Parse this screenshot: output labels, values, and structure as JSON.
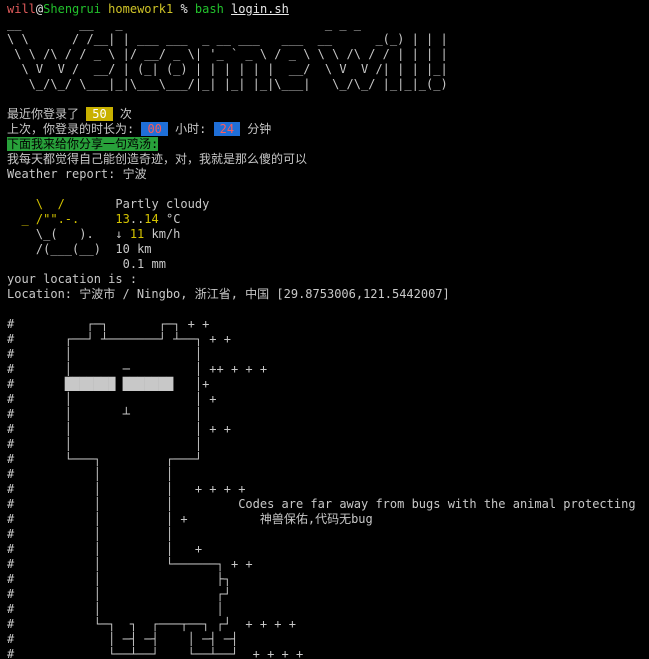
{
  "prompt": {
    "user": "will",
    "at": "@",
    "host": "Shengrui",
    "dir": "homework1",
    "sym": "%"
  },
  "command": {
    "bash": "bash",
    "script": "login.sh"
  },
  "banner": [
    "__        __   _                            _ _ _   ",
    "\\ \\      / /__| | ___ ___  _ __ ___   ___  __      _(_) | | |",
    " \\ \\ /\\ / / _ \\ |/ __/ _ \\| '_ ` _ \\ / _ \\ \\ \\ /\\ / / | | | |",
    "  \\ V  V /  __/ | (_| (_) | | | | | |  __/  \\ V  V /| | | |_|",
    "   \\_/\\_/ \\___|_|\\___\\___/|_| |_| |_|\\___|   \\_/\\_/ |_|_|_(_)"
  ],
  "login_count": {
    "pre": "最近你登录了 ",
    "value": "50",
    "post": " 次"
  },
  "last_login": {
    "pre": "上次，你登录的时长为: ",
    "hours": "00",
    "mid": " 小时: ",
    "minutes": "24",
    "post": " 分钟"
  },
  "soup_header": "下面我来给你分享一句鸡汤:",
  "soup": "我每天都觉得自己能创造奇迹，对，我就是那么傻的可以",
  "weather": {
    "label": "Weather report: ",
    "city": "宁波",
    "art": [
      "    \\  /   ",
      "  _ /\"\".-.  ",
      "    \\_(   ). ",
      "    /(___(__) ",
      "            "
    ],
    "condition": "Partly cloudy",
    "temp": {
      "low": "13",
      "sep": "..",
      "high": "14",
      "unit": " °C"
    },
    "wind": {
      "arrow": "↓ ",
      "speed": "11",
      "unit": " km/h"
    },
    "visibility": "10 km",
    "precip": "0.1 mm"
  },
  "location": {
    "prompt": "your location is :",
    "text": "Location: 宁波市 / Ningbo, 浙江省, 中国 [29.8753006,121.5442007]"
  },
  "animal": [
    "#          ┌─┐       ┌─┐ + +",
    "#       ┌──┘ ┴───────┘ ┴──┐ + +",
    "#       │                 │",
    "#       │       ─         │ ++ + + +",
    "#       ███████ ███████   │+",
    "#       │                 │ +",
    "#       │       ┴         │",
    "#       │                 │ + +",
    "#       │                 │",
    "#       └───┐         ┌───┘",
    "#           │         │",
    "#           │         │   + + + +",
    "#           │         │         Codes are far away from bugs with the animal protecting",
    "#           │         │ +          神兽保佑,代码无bug",
    "#           │         │",
    "#           │         │   +",
    "#           │         └──────┐ + +",
    "#           │                ├┐",
    "#           │                ┌┘",
    "#           │                │",
    "#           └─┐  ┐  ┌───┬──┐ ┌┘  + + + +",
    "#             │ ─┤ ─┤    │ ─┤ ─┤",
    "#             └──┴──┘    └──┴──┘  + + + +"
  ]
}
